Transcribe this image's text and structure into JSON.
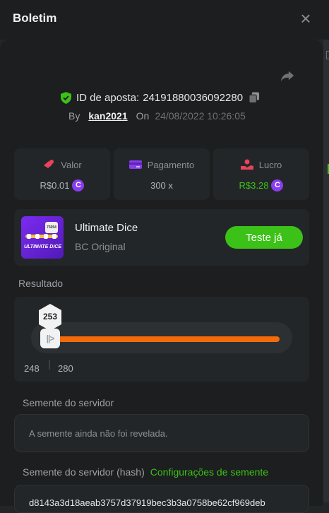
{
  "header": {
    "title": "Boletim",
    "close_icon": "×"
  },
  "bet": {
    "id_label": "ID de aposta:",
    "id_value": "24191880036092280",
    "by_label": "By",
    "user": "kan2021",
    "on_label": "On",
    "date": "24/08/2022 10:26:05"
  },
  "stats": {
    "valor": {
      "label": "Valor",
      "value": "R$0.01",
      "icon": "coin-hand-icon"
    },
    "pagamento": {
      "label": "Pagamento",
      "value": "300 x",
      "icon": "card-icon"
    },
    "lucro": {
      "label": "Lucro",
      "value": "R$3.28",
      "icon": "hand-coin-icon"
    },
    "coin_symbol": "C"
  },
  "game": {
    "name": "Ultimate Dice",
    "provider": "BC Original",
    "thumb_title": "ULTIMATE DICE",
    "thumb_badge": "75054",
    "play_label": "Teste já"
  },
  "result": {
    "label": "Resultado",
    "value": "253",
    "min": "248",
    "max": "280"
  },
  "seed": {
    "server_label": "Semente do servidor",
    "server_placeholder": "A semente ainda não foi revelada.",
    "hash_label": "Semente do servidor (hash)",
    "config_link": "Configurações de semente",
    "hash_value": "d8143a3d18aeab3757d37919bec3b3a0758be62cf969deb"
  },
  "colors": {
    "accent_green": "#3bc117",
    "accent_orange": "#f46a0a",
    "coin_purple": "#8a3df0",
    "background": "#1c1e20"
  }
}
